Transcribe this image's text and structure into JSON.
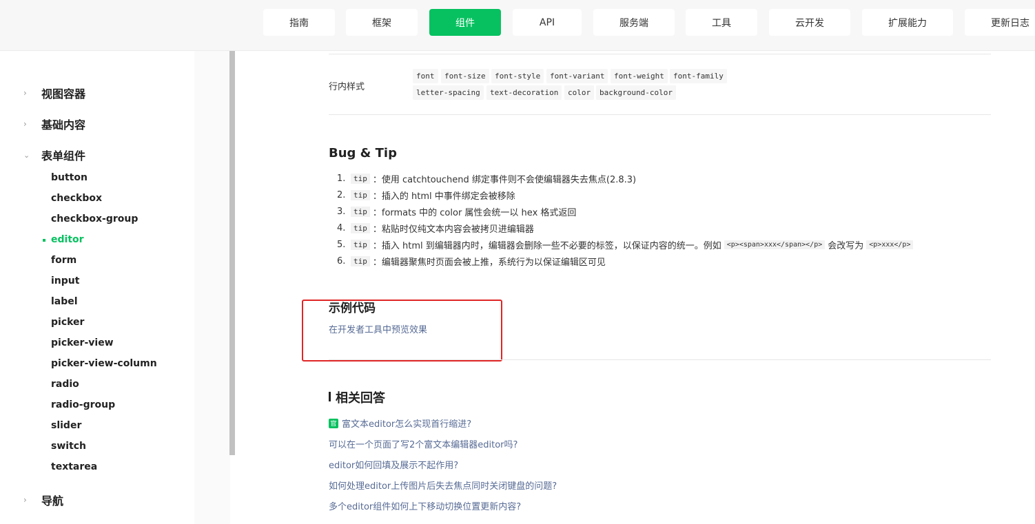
{
  "nav": {
    "tabs": [
      {
        "label": "指南"
      },
      {
        "label": "框架"
      },
      {
        "label": "组件",
        "active": true
      },
      {
        "label": "API"
      },
      {
        "label": "服务端"
      },
      {
        "label": "工具"
      },
      {
        "label": "云开发"
      },
      {
        "label": "扩展能力"
      },
      {
        "label": "更新日志"
      }
    ],
    "active_color": "#07c160"
  },
  "sidebar": {
    "groups": [
      {
        "label": "视图容器",
        "icon": "chevron-right-icon"
      },
      {
        "label": "基础内容",
        "icon": "chevron-right-icon"
      },
      {
        "label": "表单组件",
        "icon": "chevron-down-icon"
      },
      {
        "label": "导航",
        "icon": "chevron-right-icon"
      }
    ],
    "form_items": [
      "button",
      "checkbox",
      "checkbox-group",
      "editor",
      "form",
      "input",
      "label",
      "picker",
      "picker-view",
      "picker-view-column",
      "radio",
      "radio-group",
      "slider",
      "switch",
      "textarea"
    ],
    "active_item": "editor"
  },
  "inline_style": {
    "label": "行内样式",
    "row1": [
      "font",
      "font-size",
      "font-style",
      "font-variant",
      "font-weight",
      "font-family"
    ],
    "row2": [
      "letter-spacing",
      "text-decoration",
      "color",
      "background-color"
    ]
  },
  "bug_tip": {
    "title": "Bug & Tip",
    "items": [
      {
        "num": "1.",
        "tag": "tip",
        "text": "：使用 catchtouchend 绑定事件则不会使编辑器失去焦点(2.8.3)"
      },
      {
        "num": "2.",
        "tag": "tip",
        "text": "：插入的 html 中事件绑定会被移除"
      },
      {
        "num": "3.",
        "tag": "tip",
        "text": "：formats 中的 color 属性会统一以 hex 格式返回"
      },
      {
        "num": "4.",
        "tag": "tip",
        "text": "：粘贴时仅纯文本内容会被拷贝进编辑器"
      },
      {
        "num": "5.",
        "tag": "tip",
        "text": "：插入 html 到编辑器内时，编辑器会删除一些不必要的标签，以保证内容的统一。例如",
        "code1": "<p><span>xxx</span></p>",
        "mid": "会改写为",
        "code2": "<p>xxx</p>"
      },
      {
        "num": "6.",
        "tag": "tip",
        "text": "：编辑器聚焦时页面会被上推，系统行为以保证编辑区可见"
      }
    ]
  },
  "sample": {
    "title": "示例代码",
    "link": "在开发者工具中预览效果"
  },
  "related": {
    "title": "相关回答",
    "official_badge": "官",
    "items": [
      "富文本editor怎么实现首行缩进?",
      "可以在一个页面了写2个富文本编辑器editor吗?",
      "editor如何回填及展示不起作用?",
      "如何处理editor上传图片后失去焦点同时关闭键盘的问题?",
      "多个editor组件如何上下移动切换位置更新内容?"
    ]
  }
}
